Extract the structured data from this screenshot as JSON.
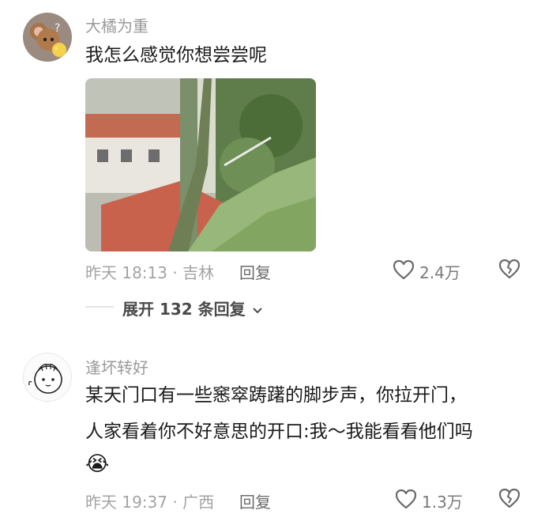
{
  "comments": [
    {
      "username": "大橘为重",
      "text": "我怎么感觉你想尝尝呢",
      "meta": "昨天 18:13 · 吉林",
      "reply_label": "回复",
      "like_count": "2.4万"
    },
    {
      "username": "逢坏转好",
      "text_line1": "某天门口有一些窸窣踌躇的脚步声，你拉开门，",
      "text_line2": "人家看着你不好意思的开口:我～我能看看他们吗",
      "emoji": "😭",
      "meta": "昨天 19:37 · 广西",
      "reply_label": "回复",
      "like_count": "1.3万"
    }
  ],
  "expand": {
    "label": "展开 132 条回复"
  }
}
